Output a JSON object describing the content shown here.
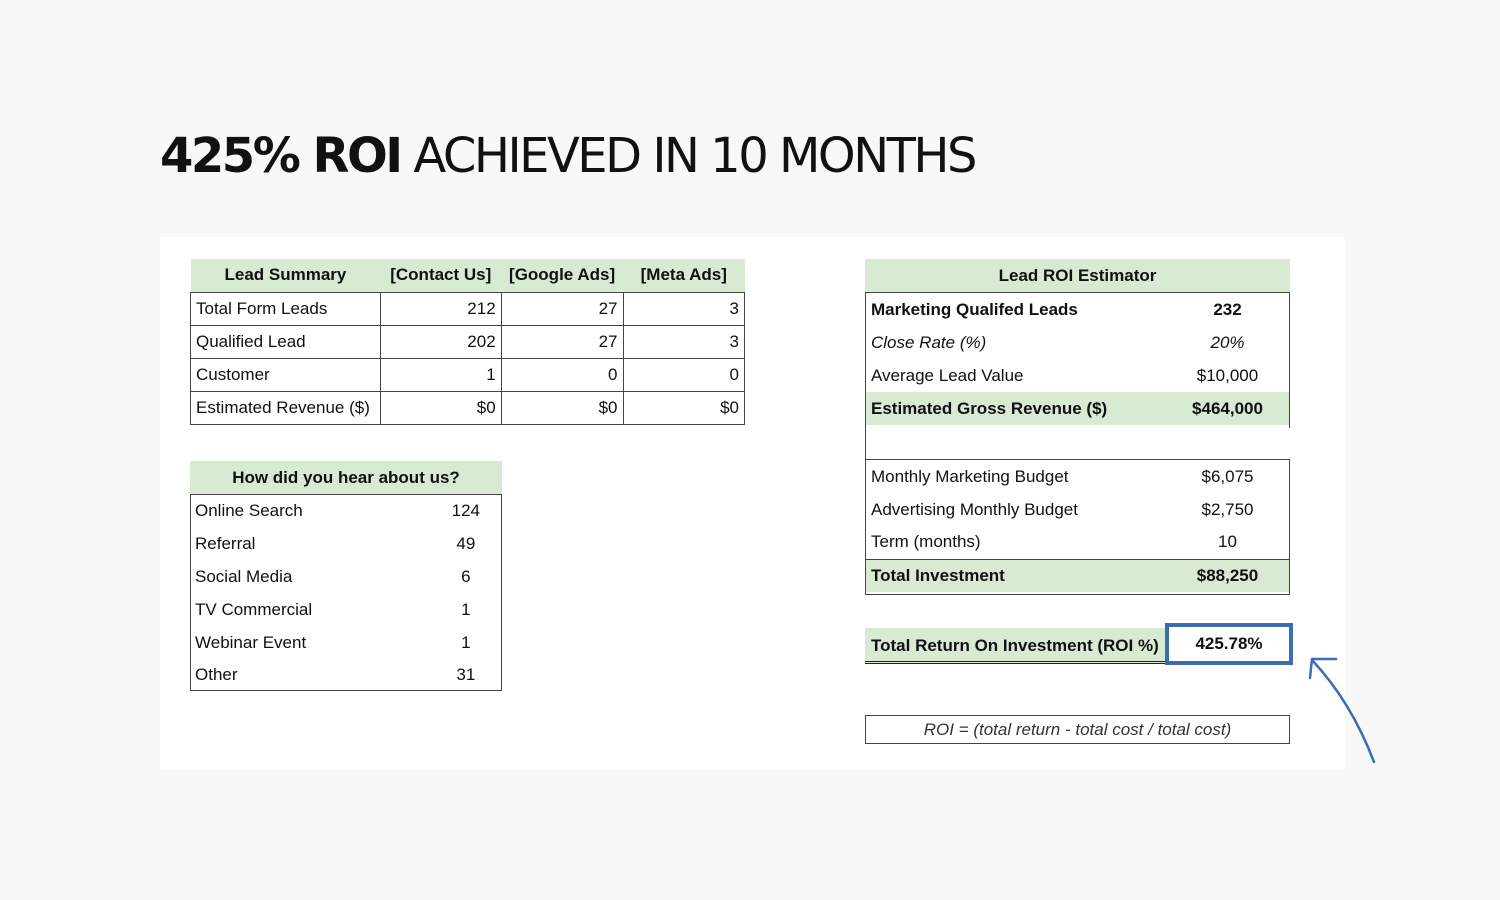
{
  "headline": {
    "bold": "425% ROI",
    "rest": " ACHIEVED IN 10 MONTHS"
  },
  "lead_summary": {
    "headers": [
      "Lead Summary",
      "[Contact Us]",
      "[Google Ads]",
      "[Meta Ads]"
    ],
    "rows": [
      [
        "Total Form Leads",
        "212",
        "27",
        "3"
      ],
      [
        "Qualified Lead",
        "202",
        "27",
        "3"
      ],
      [
        "Customer",
        "1",
        "0",
        "0"
      ],
      [
        "Estimated Revenue ($)",
        "$0",
        "$0",
        "$0"
      ]
    ]
  },
  "hear_about": {
    "header": "How did you hear about us?",
    "rows": [
      [
        "Online Search",
        "124"
      ],
      [
        "Referral",
        "49"
      ],
      [
        "Social Media",
        "6"
      ],
      [
        "TV Commercial",
        "1"
      ],
      [
        "Webinar Event",
        "1"
      ],
      [
        "Other",
        "31"
      ]
    ]
  },
  "roi_estimator": {
    "header": "Lead ROI Estimator",
    "rows": [
      [
        "Marketing Qualifed Leads",
        "232"
      ],
      [
        "Close Rate (%)",
        "20%"
      ],
      [
        "Average Lead Value",
        "$10,000"
      ],
      [
        "Estimated Gross Revenue ($)",
        "$464,000"
      ]
    ],
    "budget_rows": [
      [
        "Monthly Marketing Budget",
        "$6,075"
      ],
      [
        "Advertising Monthly Budget",
        "$2,750"
      ],
      [
        "Term (months)",
        "10"
      ],
      [
        "Total Investment",
        "$88,250"
      ]
    ],
    "result_label": "Total Return On Investment (ROI %)",
    "result_value": "425.78%",
    "formula": "ROI = (total return - total cost / total cost)"
  },
  "colors": {
    "header_green": "#d9ead3",
    "highlight_blue": "#3b6db3"
  }
}
